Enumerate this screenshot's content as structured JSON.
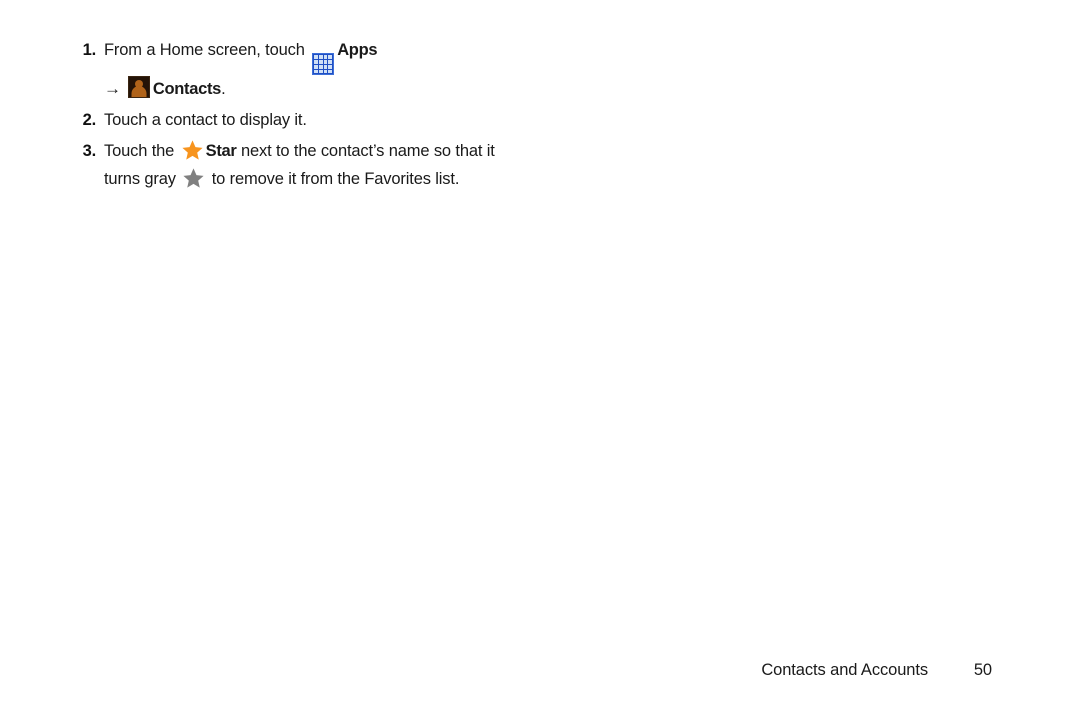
{
  "document": {
    "type": "user-manual-page",
    "background_color": "#ffffff",
    "text_color": "#1a1a1a"
  },
  "steps": [
    {
      "number": "1.",
      "lines": [
        {
          "segments": [
            {
              "kind": "text",
              "value": "From a Home screen, touch "
            },
            {
              "kind": "icon",
              "icon": "apps-grid-icon"
            },
            {
              "kind": "bold",
              "value": "Apps"
            }
          ]
        },
        {
          "segments": [
            {
              "kind": "arrow",
              "value": "→"
            },
            {
              "kind": "icon",
              "icon": "contacts-person-icon"
            },
            {
              "kind": "bold",
              "value": "Contacts"
            },
            {
              "kind": "text",
              "value": "."
            }
          ]
        }
      ]
    },
    {
      "number": "2.",
      "lines": [
        {
          "segments": [
            {
              "kind": "text",
              "value": "Touch a contact to display it."
            }
          ]
        }
      ]
    },
    {
      "number": "3.",
      "lines": [
        {
          "segments": [
            {
              "kind": "text",
              "value": "Touch the "
            },
            {
              "kind": "icon",
              "icon": "star-orange-icon"
            },
            {
              "kind": "bold",
              "value": "Star"
            },
            {
              "kind": "text",
              "value": " next to the contact’s name so that it"
            }
          ]
        },
        {
          "segments": [
            {
              "kind": "text",
              "value": "turns gray "
            },
            {
              "kind": "icon",
              "icon": "star-gray-icon"
            },
            {
              "kind": "text",
              "value": " to remove it from the Favorites list."
            }
          ]
        }
      ]
    }
  ],
  "step_text": {
    "s1_num": "1.",
    "s1_l1_a": "From a Home screen, touch ",
    "s1_l1_apps": "Apps",
    "s1_l2_arrow": "→",
    "s1_l2_contacts": "Contacts",
    "s1_l2_period": ".",
    "s2_num": "2.",
    "s2_l1": "Touch a contact to display it.",
    "s3_num": "3.",
    "s3_l1_a": "Touch the ",
    "s3_l1_star": "Star",
    "s3_l1_b": " next to the contact’s name so that it",
    "s3_l2_a": "turns gray ",
    "s3_l2_b": " to remove it from the Favorites list."
  },
  "icons": {
    "apps_grid": {
      "name": "apps-grid-icon",
      "background_color": "#1f4fc4",
      "border_color": "#3d6fd8",
      "cell_color": "#cfe0f7",
      "rows": 4,
      "columns": 4
    },
    "contacts_person": {
      "name": "contacts-person-icon",
      "background_color": "#241307",
      "figure_color": "#b0631a"
    },
    "star_orange": {
      "name": "star-orange-icon",
      "color": "#f7941e"
    },
    "star_gray": {
      "name": "star-gray-icon",
      "color": "#808080"
    }
  },
  "footer": {
    "section_title": "Contacts and Accounts",
    "page_number": "50"
  }
}
